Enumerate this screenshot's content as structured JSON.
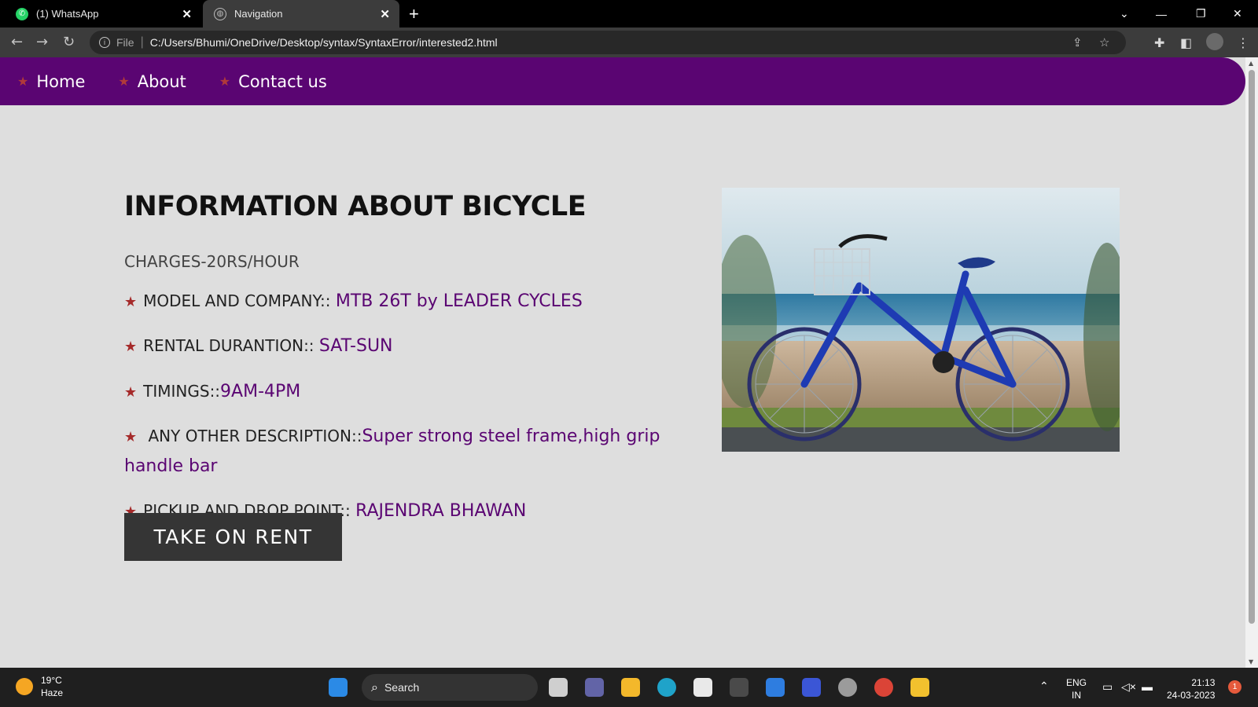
{
  "browser": {
    "tabs": [
      {
        "title": "(1) WhatsApp",
        "icon": "whatsapp-icon"
      },
      {
        "title": "Navigation",
        "icon": "globe-icon"
      }
    ],
    "address": {
      "scheme_label": "File",
      "url": "C:/Users/Bhumi/OneDrive/Desktop/syntax/SyntaxError/interested2.html"
    }
  },
  "site": {
    "nav": [
      {
        "label": "Home"
      },
      {
        "label": "About"
      },
      {
        "label": "Contact us"
      }
    ],
    "heading": "INFORMATION ABOUT BICYCLE",
    "charges": "CHARGES-20RS/HOUR",
    "details": [
      {
        "label": "MODEL AND COMPANY:: ",
        "value": "MTB 26T by LEADER CYCLES"
      },
      {
        "label": "RENTAL DURANTION:: ",
        "value": "SAT-SUN"
      },
      {
        "label": "TIMINGS::",
        "value": "9AM-4PM"
      },
      {
        "label": " ANY OTHER DESCRIPTION::",
        "value": "Super strong steel frame,high grip handle bar"
      },
      {
        "label": "PICKUP AND DROP POINT:: ",
        "value": "RAJENDRA BHAWAN"
      }
    ],
    "button_label": "TAKE ON RENT",
    "colors": {
      "nav_bg": "#5a0572",
      "accent_value": "#5a0572",
      "star": "#a52a2a",
      "button_bg": "#353535"
    }
  },
  "taskbar": {
    "weather": {
      "temp": "19°C",
      "condition": "Haze"
    },
    "search_label": "Search",
    "language": {
      "line1": "ENG",
      "line2": "IN"
    },
    "clock": {
      "time": "21:13",
      "date": "24-03-2023"
    },
    "notification_count": "1"
  }
}
